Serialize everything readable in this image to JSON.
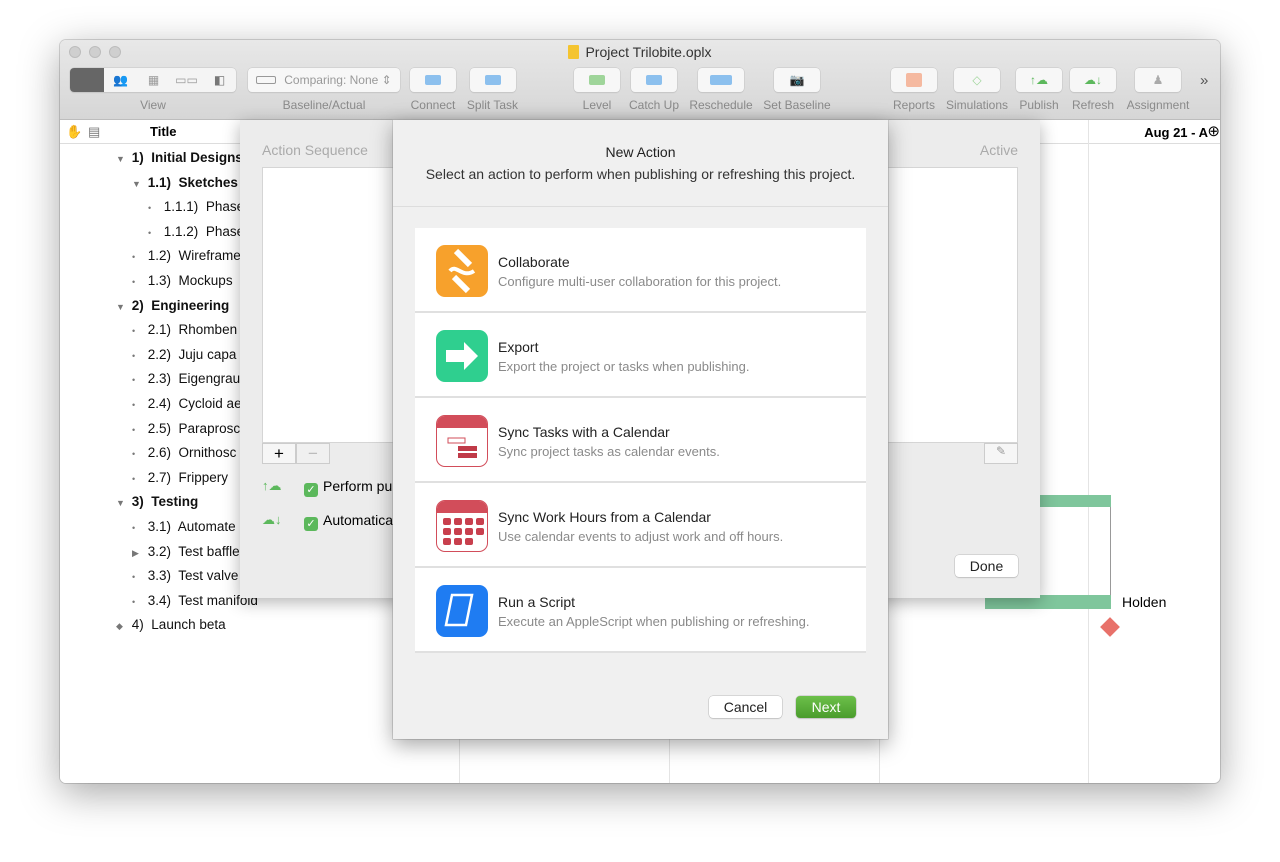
{
  "window": {
    "title": "Project Trilobite.oplx"
  },
  "toolbar": {
    "view": "View",
    "comparing": "Comparing: None",
    "baseline": "Baseline/Actual",
    "connect": "Connect",
    "split": "Split Task",
    "level": "Level",
    "catchup": "Catch Up",
    "reschedule": "Reschedule",
    "setbaseline": "Set Baseline",
    "reports": "Reports",
    "simulations": "Simulations",
    "publish": "Publish",
    "refresh": "Refresh",
    "assignment": "Assignment",
    "overflow": "»"
  },
  "outline": {
    "title_header": "Title",
    "date_header": "Aug 21 - A",
    "rows": [
      {
        "num": "1)",
        "text": "Initial Designs",
        "marker": "▼",
        "bold": true,
        "level": 0
      },
      {
        "num": "1.1)",
        "text": "Sketches",
        "marker": "▼",
        "bold": true,
        "level": 1
      },
      {
        "num": "1.1.1)",
        "text": "Phase",
        "marker": "•",
        "level": 2
      },
      {
        "num": "1.1.2)",
        "text": "Phase",
        "marker": "•",
        "level": 2
      },
      {
        "num": "1.2)",
        "text": "Wireframe",
        "marker": "•",
        "level": 1
      },
      {
        "num": "1.3)",
        "text": "Mockups",
        "marker": "•",
        "level": 1
      },
      {
        "num": "2)",
        "text": "Engineering",
        "marker": "▼",
        "bold": true,
        "level": 0
      },
      {
        "num": "2.1)",
        "text": "Rhomben",
        "marker": "•",
        "level": 1
      },
      {
        "num": "2.2)",
        "text": "Juju capa",
        "marker": "•",
        "level": 1
      },
      {
        "num": "2.3)",
        "text": "Eigengrau",
        "marker": "•",
        "level": 1
      },
      {
        "num": "2.4)",
        "text": "Cycloid ae",
        "marker": "•",
        "level": 1
      },
      {
        "num": "2.5)",
        "text": "Paraprosc",
        "marker": "•",
        "level": 1
      },
      {
        "num": "2.6)",
        "text": "Ornithosc",
        "marker": "•",
        "level": 1
      },
      {
        "num": "2.7)",
        "text": "Frippery",
        "marker": "•",
        "level": 1
      },
      {
        "num": "3)",
        "text": "Testing",
        "marker": "▼",
        "bold": true,
        "level": 0
      },
      {
        "num": "3.1)",
        "text": "Automate",
        "marker": "•",
        "level": 1
      },
      {
        "num": "3.2)",
        "text": "Test baffle",
        "marker": "▶",
        "level": 1
      },
      {
        "num": "3.3)",
        "text": "Test valve",
        "marker": "•",
        "level": 1
      },
      {
        "num": "3.4)",
        "text": "Test manifold",
        "marker": "•",
        "level": 1
      },
      {
        "num": "4)",
        "text": "Launch beta",
        "marker": "◆",
        "level": 0
      }
    ]
  },
  "gantt": {
    "resource": "Holden"
  },
  "sheet": {
    "action_sequence": "Action Sequence",
    "active": "Active",
    "add": "+",
    "remove": "−",
    "perform": "Perform pu",
    "auto": "Automatica",
    "done": "Done"
  },
  "dialog": {
    "title": "New Action",
    "subtitle": "Select an action to perform when publishing or refreshing this project.",
    "actions": [
      {
        "title": "Collaborate",
        "desc": "Configure multi-user collaboration for this project.",
        "icon": "collaborate-icon",
        "color": "#f7a12c"
      },
      {
        "title": "Export",
        "desc": "Export the project or tasks when publishing.",
        "icon": "export-arrow-icon",
        "color": "#2fcf8f"
      },
      {
        "title": "Sync Tasks with a Calendar",
        "desc": "Sync project tasks as calendar events.",
        "icon": "calendar-tasks-icon",
        "color": "#d24d5a"
      },
      {
        "title": "Sync Work Hours from a Calendar",
        "desc": "Use calendar events to adjust work and off hours.",
        "icon": "calendar-grid-icon",
        "color": "#d24d5a"
      },
      {
        "title": "Run a Script",
        "desc": "Execute an AppleScript when publishing or refreshing.",
        "icon": "script-scroll-icon",
        "color": "#1f7cf2"
      }
    ],
    "cancel": "Cancel",
    "next": "Next"
  },
  "colors": {
    "accent_green": "#5aa832",
    "gantt_bar": "#7fc69c",
    "milestone": "#e8716a"
  }
}
